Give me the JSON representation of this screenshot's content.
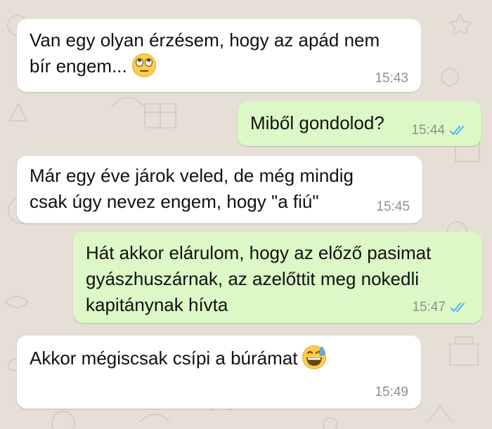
{
  "messages": [
    {
      "direction": "incoming",
      "lines": [
        "Van egy olyan érzésem, hogy az apád nem",
        "bír engem..."
      ],
      "emoji": "face-with-rolling-eyes-icon",
      "time": "15:43"
    },
    {
      "direction": "outgoing",
      "lines": [
        "Miből gondolod?"
      ],
      "time": "15:44",
      "status": "read"
    },
    {
      "direction": "incoming",
      "lines": [
        "Már egy éve járok veled, de még mindig",
        "csak úgy nevez engem, hogy \"a fiú\""
      ],
      "time": "15:45"
    },
    {
      "direction": "outgoing",
      "lines": [
        "Hát akkor elárulom, hogy az előző pasimat",
        "gyászhuszárnak, az azelőttit meg nokedli",
        "kapitánynak hívta"
      ],
      "time": "15:47",
      "status": "read"
    },
    {
      "direction": "incoming",
      "lines": [
        "Akkor mégiscsak csípi a búrámat"
      ],
      "emoji": "grinning-face-with-sweat-icon",
      "time": "15:49"
    }
  ],
  "colors": {
    "wallpaper": "#e6dfd6",
    "incoming_bubble": "#ffffff",
    "outgoing_bubble": "#dcf8c6",
    "timestamp": "#8f8f8f",
    "read_ticks": "#4fb6ec"
  }
}
